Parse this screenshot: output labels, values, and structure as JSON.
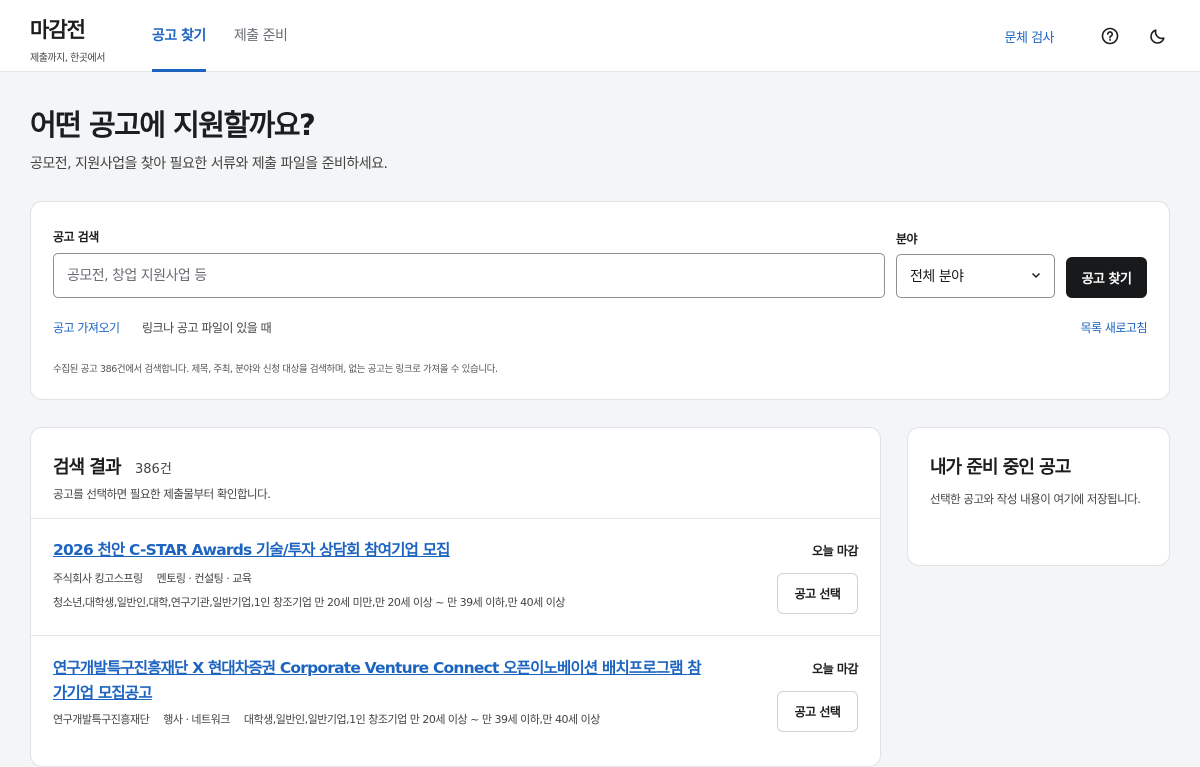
{
  "brand": {
    "name": "마감전",
    "tagline": "제출까지, 한곳에서"
  },
  "nav": {
    "tabs": [
      {
        "label": "공고 찾기",
        "active": true
      },
      {
        "label": "제출 준비",
        "active": false
      }
    ]
  },
  "header_actions": {
    "issue_check": "문체 검사",
    "help_icon": "help-circle-icon",
    "theme_icon": "moon-icon"
  },
  "page": {
    "title": "어떤 공고에 지원할까요?",
    "subtitle": "공모전, 지원사업을 찾아 필요한 서류와 제출 파일을 준비하세요."
  },
  "search": {
    "label": "공고 검색",
    "placeholder": "공모전, 창업 지원사업 등",
    "value": "",
    "category_label": "분야",
    "category_value": "전체 분야",
    "submit_label": "공고 찾기",
    "import_link": "공고 가져오기",
    "import_hint": "링크나 공고 파일이 있을 때",
    "refresh_link": "목록 새로고침",
    "note": "수집된 공고 386건에서 검색합니다. 제목, 주최, 분야와 신청 대상을 검색하며, 없는 공고는 링크로 가져올 수 있습니다."
  },
  "results": {
    "title": "검색 결과",
    "count": "386건",
    "description": "공고를 선택하면 필요한 제출물부터 확인합니다.",
    "items": [
      {
        "title": "2026 천안 C-STAR Awards 기술/투자 상담회 참여기업 모집",
        "organizer": "주식회사 킹고스프링",
        "category": "멘토링 · 컨설팅 · 교육",
        "target": "청소년,대학생,일반인,대학,연구기관,일반기업,1인 창조기업 만 20세 미만,만 20세 이상 ~ 만 39세 이하,만 40세 이상",
        "deadline": "오늘 마감",
        "action": "공고 선택"
      },
      {
        "title": "연구개발특구진흥재단 X 현대차증권 Corporate Venture Connect 오픈이노베이션 배치프로그램 참가기업 모집공고",
        "organizer": "연구개발특구진흥재단",
        "category": "행사 · 네트워크",
        "target": "대학생,일반인,일반기업,1인 창조기업 만 20세 이상 ~ 만 39세 이하,만 40세 이상",
        "deadline": "오늘 마감",
        "action": "공고 선택"
      }
    ]
  },
  "sidebar": {
    "title": "내가 준비 중인 공고",
    "description": "선택한 공고와 작성 내용이 여기에 저장됩니다."
  }
}
